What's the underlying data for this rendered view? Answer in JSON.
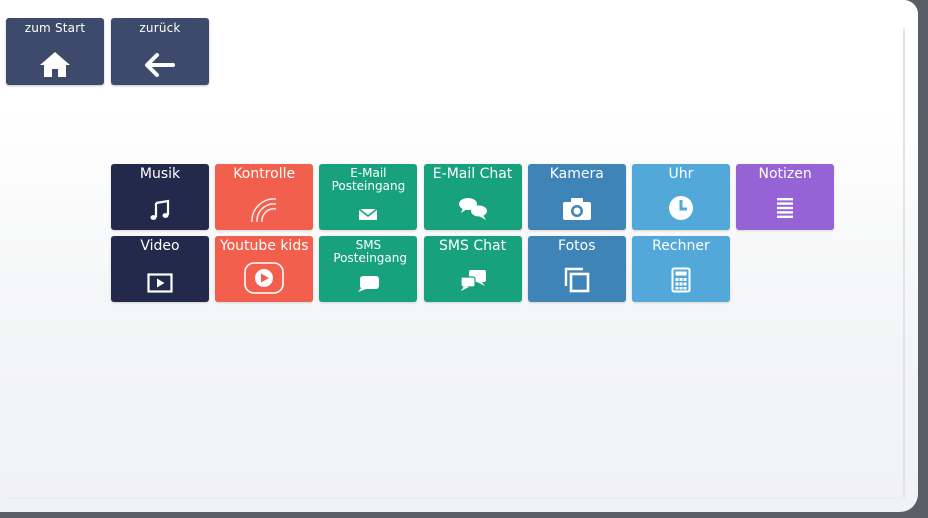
{
  "nav": {
    "home_label": "zum Start",
    "back_label": "zurück"
  },
  "tiles": [
    {
      "label": "Musik",
      "color": "#23294a",
      "icon": "music-note-icon"
    },
    {
      "label": "Kontrolle",
      "color": "#f25f4c",
      "icon": "signal-waves-icon"
    },
    {
      "label": "E-Mail Posteingang",
      "color": "#17a17d",
      "icon": "envelope-icon"
    },
    {
      "label": "E-Mail Chat",
      "color": "#17a17d",
      "icon": "chat-bubbles-icon"
    },
    {
      "label": "Kamera",
      "color": "#3f84b6",
      "icon": "camera-icon"
    },
    {
      "label": "Uhr",
      "color": "#51a8d9",
      "icon": "clock-icon"
    },
    {
      "label": "Notizen",
      "color": "#9563d6",
      "icon": "notes-lines-icon"
    },
    {
      "label": "Video",
      "color": "#23294a",
      "icon": "video-play-icon"
    },
    {
      "label": "Youtube kids",
      "color": "#f25f4c",
      "icon": "youtube-play-icon"
    },
    {
      "label": "SMS Posteingang",
      "color": "#17a17d",
      "icon": "message-bubble-icon"
    },
    {
      "label": "SMS Chat",
      "color": "#17a17d",
      "icon": "sms-chat-icon"
    },
    {
      "label": "Fotos",
      "color": "#3f84b6",
      "icon": "photos-stack-icon"
    },
    {
      "label": "Rechner",
      "color": "#51a8d9",
      "icon": "calculator-icon"
    }
  ]
}
